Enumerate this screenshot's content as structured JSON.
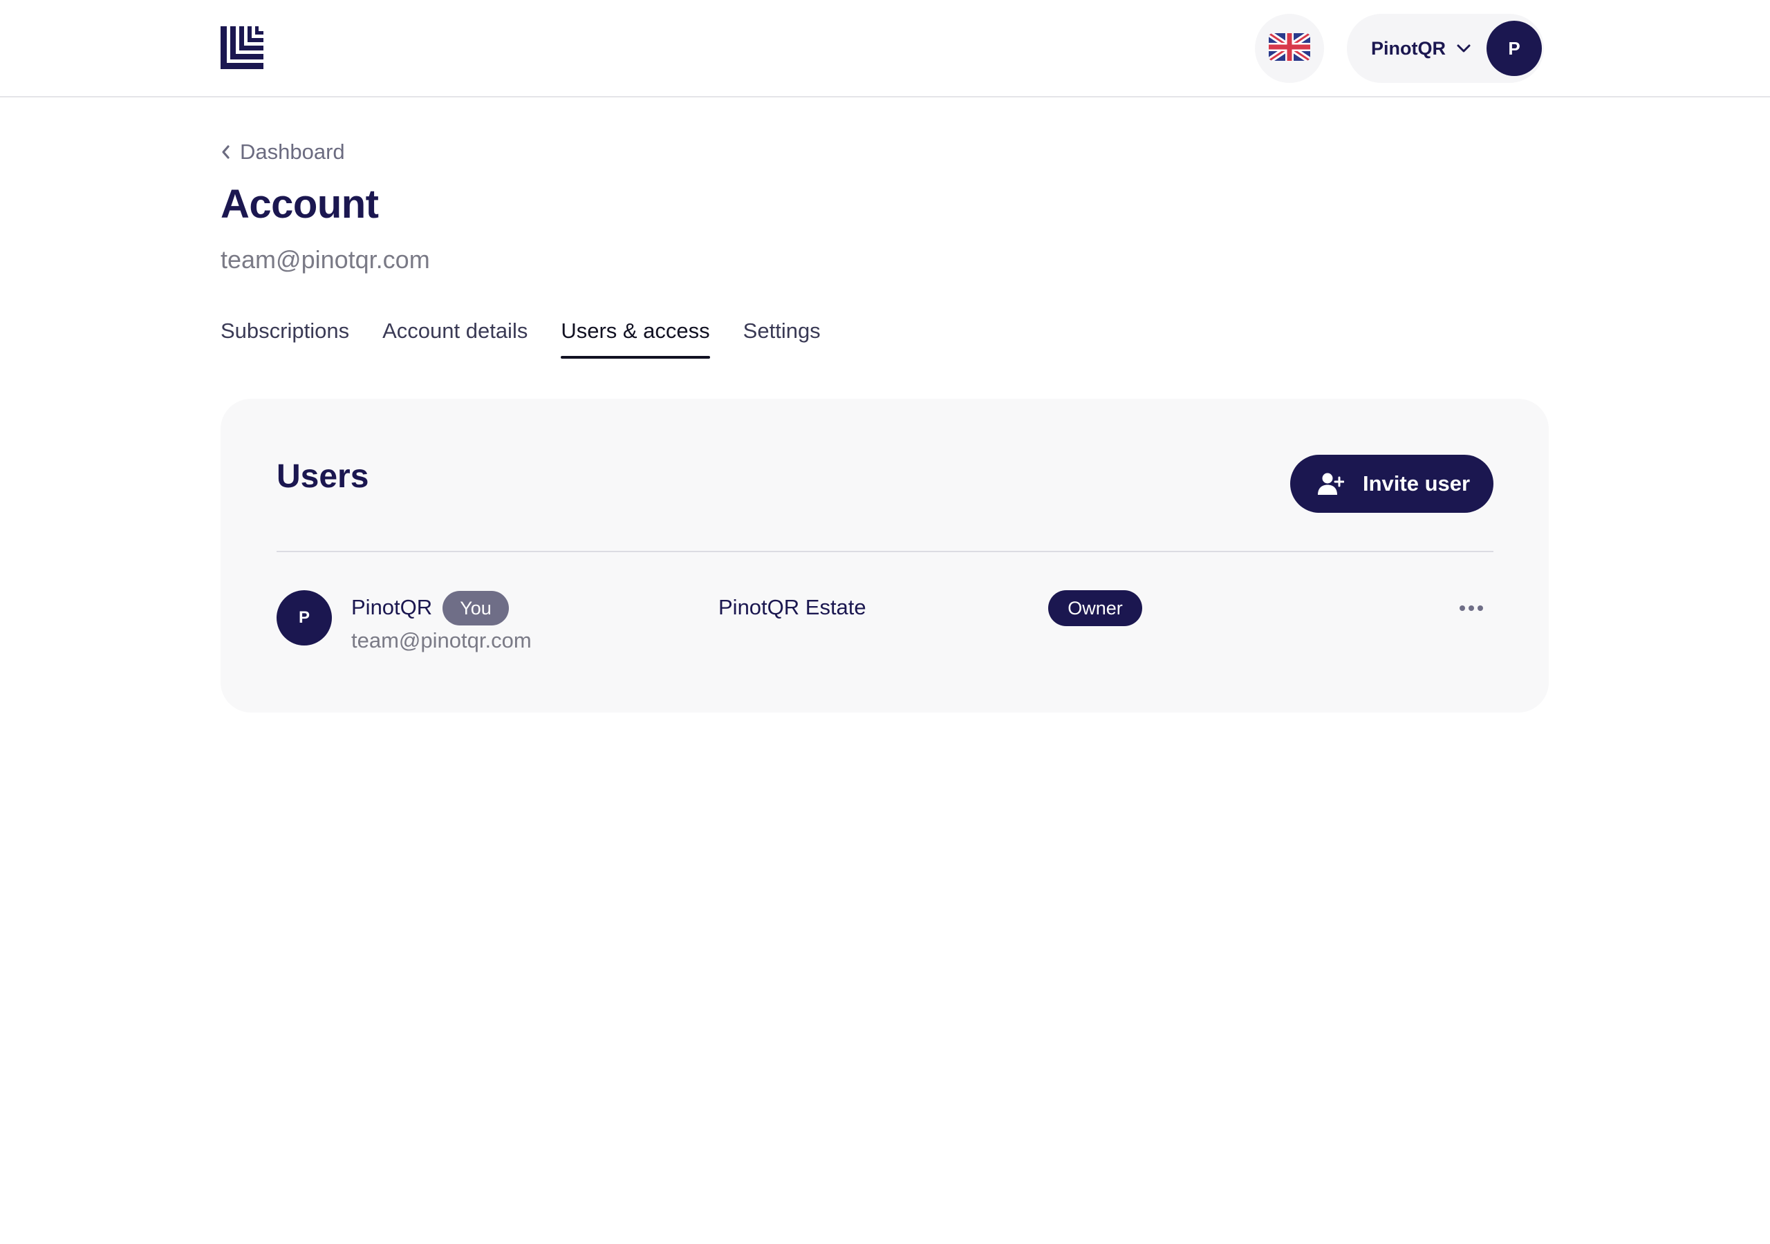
{
  "header": {
    "logo_icon": "brand-logo-icon",
    "language": {
      "icon": "uk-flag-icon",
      "label": "English"
    },
    "account": {
      "name": "PinotQR",
      "avatar_initial": "P",
      "chevron_icon": "chevron-down-icon"
    }
  },
  "breadcrumb": {
    "label": "Dashboard",
    "icon": "chevron-left-icon"
  },
  "page": {
    "title": "Account",
    "subtitle": "team@pinotqr.com"
  },
  "tabs": [
    {
      "label": "Subscriptions",
      "active": false
    },
    {
      "label": "Account details",
      "active": false
    },
    {
      "label": "Users & access",
      "active": true
    },
    {
      "label": "Settings",
      "active": false
    }
  ],
  "users_card": {
    "title": "Users",
    "invite_button": {
      "label": "Invite user",
      "icon": "add-user-icon"
    },
    "rows": [
      {
        "avatar_initial": "P",
        "name": "PinotQR",
        "you_badge": "You",
        "email": "team@pinotqr.com",
        "organization": "PinotQR Estate",
        "role": "Owner",
        "more_icon": "more-horizontal-icon"
      }
    ]
  },
  "colors": {
    "brand_navy": "#1b1750",
    "card_background": "#f8f8f9",
    "muted_text": "#7a7a86",
    "you_badge": "#6f6e87"
  }
}
